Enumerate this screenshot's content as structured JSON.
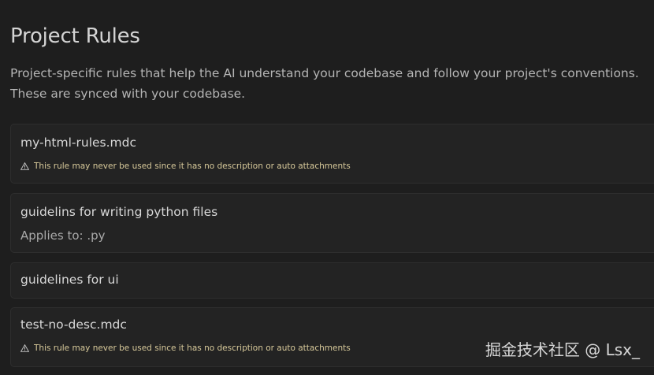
{
  "header": {
    "title": "Project Rules",
    "description_line1": "Project-specific rules that help the AI understand your codebase and follow your project's conventions.",
    "description_line2": "These are synced with your codebase."
  },
  "rules": [
    {
      "name": "my-html-rules.mdc",
      "warning": "This rule may never be used since it has no description or auto attachments"
    },
    {
      "name": "guidelins for writing python files",
      "applies_to": "Applies to: .py"
    },
    {
      "name": "guidelines for ui"
    },
    {
      "name": "test-no-desc.mdc",
      "warning": "This rule may never be used since it has no description or auto attachments"
    }
  ],
  "icons": {
    "warning": "warning-icon"
  },
  "colors": {
    "background": "#1e1e1e",
    "card": "#232323",
    "warning_text": "#d7c99a"
  },
  "watermark": "掘金技术社区 @ Lsx_"
}
